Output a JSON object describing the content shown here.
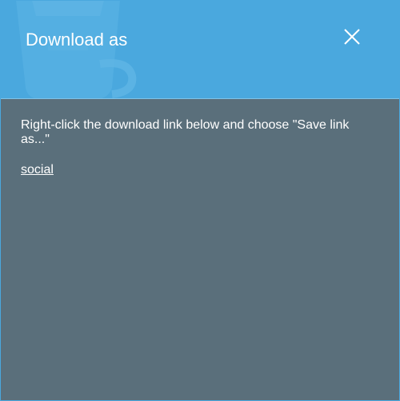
{
  "dialog": {
    "title": "Download as",
    "close_icon": "close-icon",
    "instructions": "Right-click the download link below and choose \"Save link as...\"",
    "download_link": "social"
  },
  "colors": {
    "header_bg": "#4aa8de",
    "body_bg": "#5a6f7b",
    "text": "#ffffff"
  }
}
